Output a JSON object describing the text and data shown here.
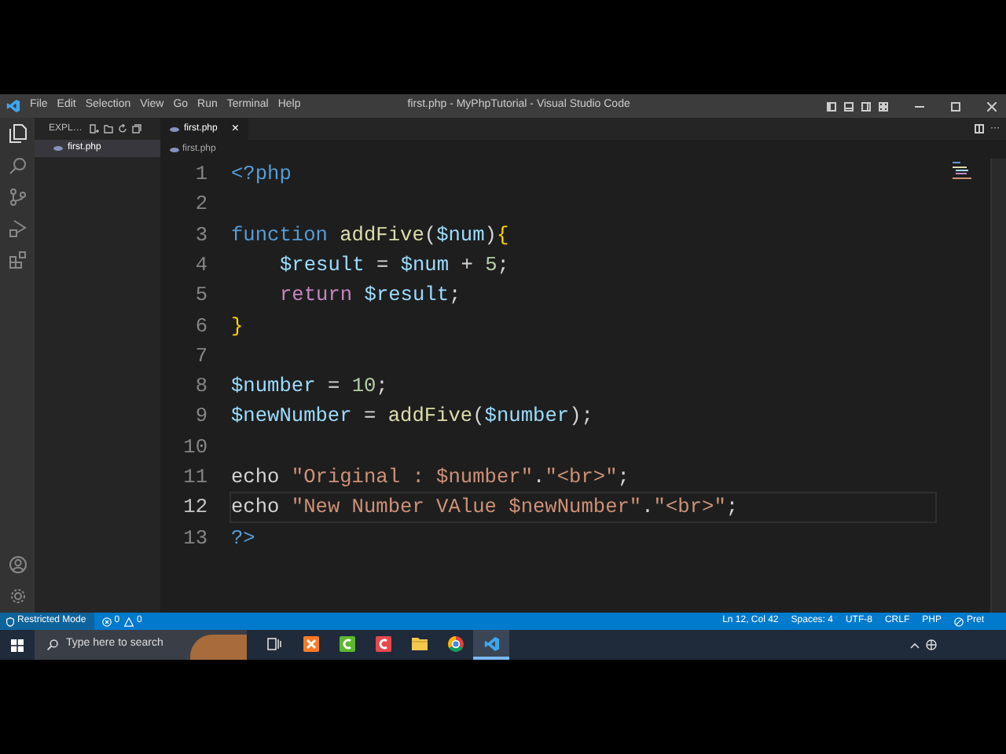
{
  "window": {
    "title": "first.php - MyPhpTutorial - Visual Studio Code"
  },
  "menu": [
    "File",
    "Edit",
    "Selection",
    "View",
    "Go",
    "Run",
    "Terminal",
    "Help"
  ],
  "explorer": {
    "header": "EXPL…",
    "open_editors": [
      {
        "label": "first.php",
        "selected": true
      }
    ]
  },
  "tabs": [
    {
      "label": "first.php",
      "selected": true,
      "close": "×"
    }
  ],
  "breadcrumb": "first.php",
  "editor_actions": {
    "more": "···"
  },
  "code_lines": [
    {
      "number": "1",
      "current": false,
      "indented": false,
      "tokens": [
        {
          "kind": "tag",
          "text": "<?php"
        }
      ]
    },
    {
      "number": "2",
      "current": false
    },
    {
      "number": "3",
      "current": false,
      "indented": false,
      "tokens": [
        {
          "kind": "keyword",
          "text": "function "
        },
        {
          "kind": "function",
          "text": "addFive"
        },
        {
          "kind": "plain",
          "text": "("
        },
        {
          "kind": "variable",
          "text": "$num"
        },
        {
          "kind": "plain",
          "text": ")"
        },
        {
          "kind": "brace",
          "text": "{"
        }
      ]
    },
    {
      "number": "4",
      "current": false,
      "indented": true,
      "tokens": [
        {
          "kind": "variable",
          "text": "$result"
        },
        {
          "kind": "plain",
          "text": " = "
        },
        {
          "kind": "variable",
          "text": "$num"
        },
        {
          "kind": "plain",
          "text": " + "
        },
        {
          "kind": "number",
          "text": "5"
        },
        {
          "kind": "plain",
          "text": ";"
        }
      ]
    },
    {
      "number": "5",
      "current": false,
      "indented": true,
      "tokens": [
        {
          "kind": "control",
          "text": "return "
        },
        {
          "kind": "variable",
          "text": "$result"
        },
        {
          "kind": "plain",
          "text": ";"
        }
      ]
    },
    {
      "number": "6",
      "current": false,
      "indented": false,
      "tokens": [
        {
          "kind": "brace",
          "text": "}"
        }
      ]
    },
    {
      "number": "7",
      "current": false
    },
    {
      "number": "8",
      "current": false,
      "indented": false,
      "tokens": [
        {
          "kind": "variable",
          "text": "$number"
        },
        {
          "kind": "plain",
          "text": " = "
        },
        {
          "kind": "number",
          "text": "10"
        },
        {
          "kind": "plain",
          "text": ";"
        }
      ]
    },
    {
      "number": "9",
      "current": false,
      "indented": false,
      "tokens": [
        {
          "kind": "variable",
          "text": "$newNumber"
        },
        {
          "kind": "plain",
          "text": " = "
        },
        {
          "kind": "function",
          "text": "addFive"
        },
        {
          "kind": "plain",
          "text": "("
        },
        {
          "kind": "variable",
          "text": "$number"
        },
        {
          "kind": "plain",
          "text": ");"
        }
      ]
    },
    {
      "number": "10",
      "current": false
    },
    {
      "number": "11",
      "current": false,
      "indented": false,
      "tokens": [
        {
          "kind": "plain",
          "text": "echo "
        },
        {
          "kind": "string",
          "text": "\"Original : $number\""
        },
        {
          "kind": "plain",
          "text": "."
        },
        {
          "kind": "string",
          "text": "\"<br>\""
        },
        {
          "kind": "plain",
          "text": ";"
        }
      ]
    },
    {
      "number": "12",
      "current": true,
      "indented": false,
      "tokens": [
        {
          "kind": "plain",
          "text": "echo "
        },
        {
          "kind": "string",
          "text": "\"New Number VAlue $newNumber\""
        },
        {
          "kind": "plain",
          "text": "."
        },
        {
          "kind": "string",
          "text": "\"<br>\""
        },
        {
          "kind": "plain",
          "text": ";"
        }
      ]
    },
    {
      "number": "13",
      "current": false,
      "indented": false,
      "tokens": [
        {
          "kind": "tag",
          "text": "?>"
        }
      ]
    }
  ],
  "status_bar": {
    "left": [
      {
        "kind": "shield",
        "text": "Restricted Mode"
      },
      {
        "kind": "error",
        "text": "0"
      },
      {
        "kind": "warning",
        "text": "0"
      }
    ],
    "right": [
      "Ln 12, Col 42",
      "Spaces: 4",
      "UTF-8",
      "CRLF",
      "PHP"
    ],
    "formatter": "Pret"
  },
  "taskbar": {
    "search": {
      "placeholder": "Type here to search"
    },
    "apps": [
      {
        "kind": "taskview",
        "selected": false
      },
      {
        "kind": "xampp",
        "selected": false
      },
      {
        "kind": "camtasia",
        "selected": false
      },
      {
        "kind": "recorder",
        "selected": false
      },
      {
        "kind": "files",
        "selected": false
      },
      {
        "kind": "chrome",
        "selected": false
      },
      {
        "kind": "vscode",
        "selected": true
      }
    ]
  }
}
